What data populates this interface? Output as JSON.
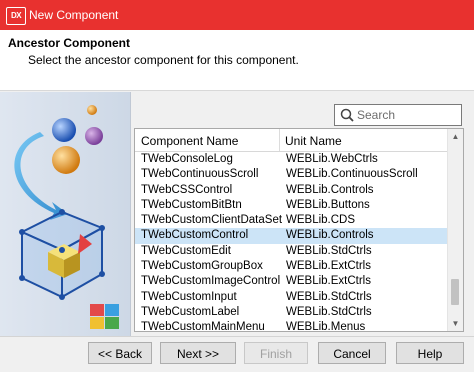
{
  "window": {
    "title": "New Component",
    "app_icon_text": "DX"
  },
  "header": {
    "title": "Ancestor Component",
    "subtitle": "Select the ancestor component for this component."
  },
  "search": {
    "placeholder": "Search",
    "value": ""
  },
  "grid": {
    "columns": [
      "Component Name",
      "Unit Name"
    ],
    "rows": [
      {
        "name": "TWebConsoleLog",
        "unit": "WEBLib.WebCtrls",
        "selected": false
      },
      {
        "name": "TWebContinuousScroll",
        "unit": "WEBLib.ContinuousScroll",
        "selected": false
      },
      {
        "name": "TWebCSSControl",
        "unit": "WEBLib.Controls",
        "selected": false
      },
      {
        "name": "TWebCustomBitBtn",
        "unit": "WEBLib.Buttons",
        "selected": false
      },
      {
        "name": "TWebCustomClientDataSet",
        "unit": "WEBLib.CDS",
        "selected": false
      },
      {
        "name": "TWebCustomControl",
        "unit": "WEBLib.Controls",
        "selected": true
      },
      {
        "name": "TWebCustomEdit",
        "unit": "WEBLib.StdCtrls",
        "selected": false
      },
      {
        "name": "TWebCustomGroupBox",
        "unit": "WEBLib.ExtCtrls",
        "selected": false
      },
      {
        "name": "TWebCustomImageControl",
        "unit": "WEBLib.ExtCtrls",
        "selected": false
      },
      {
        "name": "TWebCustomInput",
        "unit": "WEBLib.StdCtrls",
        "selected": false
      },
      {
        "name": "TWebCustomLabel",
        "unit": "WEBLib.StdCtrls",
        "selected": false
      },
      {
        "name": "TWebCustomMainMenu",
        "unit": "WEBLib.Menus",
        "selected": false
      }
    ]
  },
  "buttons": {
    "back": "<< Back",
    "next": "Next >>",
    "finish": "Finish",
    "cancel": "Cancel",
    "help": "Help"
  },
  "colors": {
    "titlebar": "#e8312f",
    "selection": "#cce4f7"
  }
}
